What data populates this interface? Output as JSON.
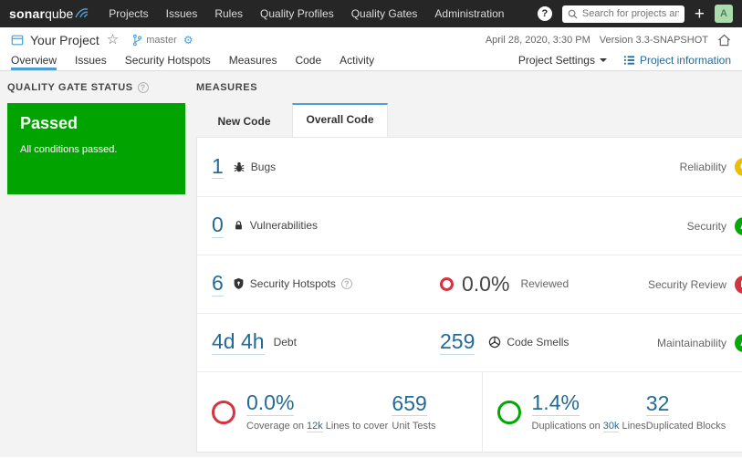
{
  "navbar": {
    "brand_bold": "sonar",
    "brand_light": "qube",
    "items": [
      "Projects",
      "Issues",
      "Rules",
      "Quality Profiles",
      "Quality Gates",
      "Administration"
    ],
    "help": "?",
    "search_placeholder": "Search for projects and files...",
    "plus": "+",
    "avatar": "A"
  },
  "project_header": {
    "name": "Your Project",
    "star": "☆",
    "branch": "master",
    "date": "April 28, 2020, 3:30 PM",
    "version": "Version 3.3-SNAPSHOT"
  },
  "tabs": {
    "items": [
      "Overview",
      "Issues",
      "Security Hotspots",
      "Measures",
      "Code",
      "Activity"
    ],
    "settings": "Project Settings",
    "info": "Project information"
  },
  "quality_gate": {
    "title": "QUALITY GATE STATUS",
    "help": "?",
    "status": "Passed",
    "subtitle": "All conditions passed."
  },
  "measures": {
    "title": "MEASURES",
    "tab_new": "New Code",
    "tab_overall": "Overall Code",
    "bugs": {
      "value": "1",
      "label": "Bugs",
      "domain": "Reliability",
      "rating": "C"
    },
    "vulnerabilities": {
      "value": "0",
      "label": "Vulnerabilities",
      "domain": "Security",
      "rating": "A"
    },
    "hotspots": {
      "value": "6",
      "label": "Security Hotspots",
      "help": "?",
      "reviewed_value": "0.0%",
      "reviewed_label": "Reviewed",
      "domain": "Security Review",
      "rating": "E"
    },
    "debt": {
      "value": "4d 4h",
      "label": "Debt",
      "smells_value": "259",
      "smells_label": "Code Smells",
      "domain": "Maintainability",
      "rating": "A"
    },
    "coverage": {
      "value": "0.0%",
      "label_prefix": "Coverage on",
      "link": "12k",
      "label_suffix": "Lines to cover",
      "tests_value": "659",
      "tests_label": "Unit Tests"
    },
    "duplications": {
      "value": "1.4%",
      "label_prefix": "Duplications on",
      "link": "30k",
      "label_suffix": "Lines",
      "blocks_value": "32",
      "blocks_label": "Duplicated Blocks"
    }
  },
  "colors": {
    "accent_blue": "#236a97",
    "tab_blue": "#4b9fd5",
    "rating_a_green": "#00aa00",
    "rating_c_yellow": "#eabe06",
    "rating_e_red": "#d4333f",
    "gate_green": "#00a300",
    "navbar_bg": "#262626"
  }
}
